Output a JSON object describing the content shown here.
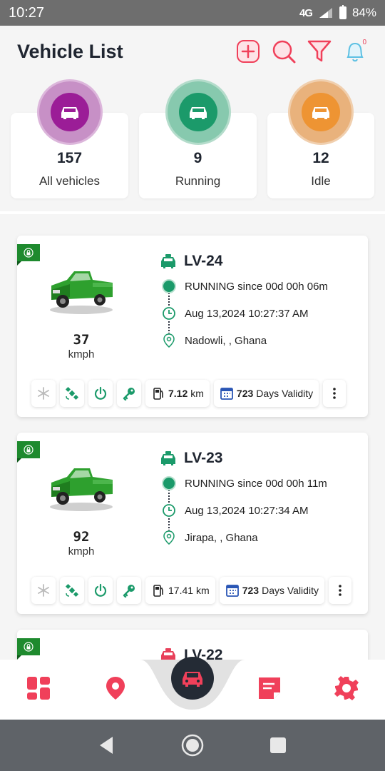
{
  "status_bar": {
    "time": "10:27",
    "network": "4G",
    "battery": "84%"
  },
  "header": {
    "title": "Vehicle List",
    "notification_count": "0"
  },
  "summary": [
    {
      "count": "157",
      "label": "All vehicles",
      "ring": "#c790c6",
      "color": "#9b1d97"
    },
    {
      "count": "9",
      "label": "Running",
      "ring": "#87c9ae",
      "color": "#1b9a6a"
    },
    {
      "count": "12",
      "label": "Idle",
      "ring": "#e9b27c",
      "color": "#ee9433"
    }
  ],
  "vehicles": [
    {
      "plate": "LV-24",
      "status": "RUNNING since  00d 00h 06m",
      "time": "Aug 13,2024 10:27:37 AM",
      "location": "Nadowli, , Ghana",
      "speed": "37",
      "speed_unit": "kmph",
      "odometer": "7.12",
      "odometer_unit": "km",
      "validity_days": "723",
      "validity_label": "Days Validity"
    },
    {
      "plate": "LV-23",
      "status": "RUNNING since  00d 00h 11m",
      "time": "Aug 13,2024 10:27:34 AM",
      "location": "Jirapa, , Ghana",
      "speed": "92",
      "speed_unit": "kmph",
      "odometer": "17.41",
      "odometer_unit": "km",
      "validity_days": "723",
      "validity_label": "Days Validity"
    },
    {
      "plate": "LV-22"
    }
  ],
  "colors": {
    "accent": "#f0405a",
    "green": "#1b9a6a",
    "dark": "#242b35"
  }
}
